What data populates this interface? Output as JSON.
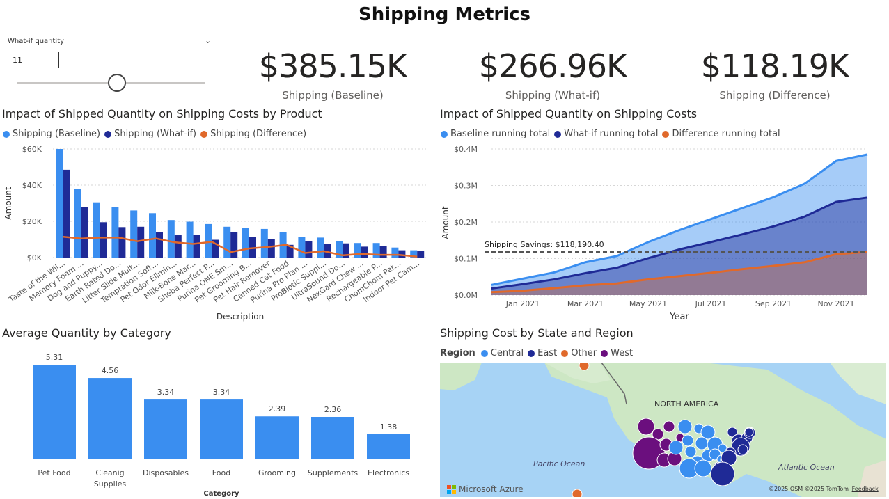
{
  "report": {
    "title": "Shipping Metrics"
  },
  "slicer": {
    "label": "What-if quantity",
    "value": "11",
    "slider_fraction": 0.53
  },
  "kpis": [
    {
      "value": "$385.15K",
      "label": "Shipping (Baseline)"
    },
    {
      "value": "$266.96K",
      "label": "Shipping (What-if)"
    },
    {
      "value": "$118.19K",
      "label": "Shipping (Difference)"
    }
  ],
  "colors": {
    "baseline": "#3a8ef0",
    "whatif": "#1f2a96",
    "difference": "#e0692b",
    "west": "#6b0f7e",
    "other": "#e0692b",
    "map_water": "#a7d3f5",
    "map_land": "#cde7c4"
  },
  "product_chart": {
    "title": "Impact of Shipped Quantity on Shipping Costs by Product",
    "legend": [
      "Shipping (Baseline)",
      "Shipping (What-if)",
      "Shipping (Difference)"
    ],
    "ylabel": "Amount",
    "xlabel": "Description",
    "chart_data": {
      "type": "bar",
      "y_ticks": [
        "$0K",
        "$20K",
        "$40K",
        "$60K"
      ],
      "ylim": [
        0,
        60000
      ],
      "categories": [
        "Taste of the Wil...",
        "Memory Foam ...",
        "Dog and Puppy...",
        "Earth Rated Do...",
        "Litter Slide Mult...",
        "Temptation Soft...",
        "Pet Odor Elimin...",
        "Milk-Bone Mar...",
        "Sheba Perfect P...",
        "Purina ONE Sm...",
        "Pet Grooming B...",
        "Pet Hair Remover",
        "Canned Cat Food",
        "Purina Pro Plan ...",
        "ProBiotic Suppl...",
        "UltraSound Do...",
        "NexGard Chew ...",
        "Rechargeable P...",
        "ChomChom Pet...",
        "Indoor Pet Cam..."
      ],
      "series": [
        {
          "name": "Shipping (Baseline)",
          "values": [
            60000,
            38000,
            30500,
            27800,
            26000,
            24500,
            20700,
            19800,
            18500,
            17000,
            16500,
            15800,
            14000,
            11500,
            11000,
            9000,
            8000,
            8000,
            5500,
            4000
          ]
        },
        {
          "name": "Shipping (What-if)",
          "values": [
            48500,
            28000,
            19500,
            16800,
            17000,
            14000,
            12300,
            12500,
            9800,
            14000,
            11500,
            10000,
            7000,
            9000,
            7500,
            7800,
            6000,
            6500,
            4000,
            3500
          ]
        },
        {
          "name": "Shipping (Difference)",
          "values": [
            11500,
            10500,
            11000,
            11000,
            9000,
            10500,
            8400,
            7500,
            8700,
            3000,
            5000,
            5800,
            7000,
            2500,
            3500,
            1200,
            2000,
            1500,
            1500,
            500
          ]
        }
      ]
    }
  },
  "running_chart": {
    "title": "Impact of Shipped Quantity on Shipping Costs",
    "legend": [
      "Baseline running total",
      "What-if running total",
      "Difference running total"
    ],
    "ylabel": "Amount",
    "xlabel": "Year",
    "annotation": "Shipping Savings: $118,190.40",
    "chart_data": {
      "type": "area",
      "y_ticks": [
        "$0.0M",
        "$0.1M",
        "$0.2M",
        "$0.3M",
        "$0.4M"
      ],
      "ylim": [
        0,
        400000
      ],
      "x_ticks": [
        "Jan 2021",
        "Mar 2021",
        "May 2021",
        "Jul 2021",
        "Sep 2021",
        "Nov 2021"
      ],
      "x": [
        "Dec 2020",
        "Jan 2021",
        "Feb 2021",
        "Mar 2021",
        "Apr 2021",
        "May 2021",
        "Jun 2021",
        "Jul 2021",
        "Aug 2021",
        "Sep 2021",
        "Oct 2021",
        "Nov 2021",
        "Dec 2021"
      ],
      "series": [
        {
          "name": "Baseline running total",
          "values": [
            28000,
            45000,
            62000,
            90000,
            107000,
            145000,
            178000,
            208000,
            238000,
            268000,
            305000,
            367000,
            385000
          ]
        },
        {
          "name": "What-if running total",
          "values": [
            18000,
            30000,
            43000,
            60000,
            75000,
            101000,
            125000,
            145000,
            166000,
            188000,
            215000,
            255000,
            267000
          ]
        },
        {
          "name": "Difference running total",
          "values": [
            8000,
            12000,
            19000,
            27000,
            32000,
            43000,
            52000,
            61000,
            71000,
            80000,
            90000,
            112000,
            118000
          ]
        }
      ],
      "reference_line": 118190.4
    }
  },
  "category_chart": {
    "title": "Average Quantity by Category",
    "xlabel": "Category",
    "chart_data": {
      "type": "bar",
      "categories": [
        "Pet Food",
        "Cleanig Supplies",
        "Disposables",
        "Food",
        "Grooming",
        "Supplements",
        "Electronics"
      ],
      "category_lines": [
        [
          "Pet Food"
        ],
        [
          "Cleanig",
          "Supplies"
        ],
        [
          "Disposables"
        ],
        [
          "Food"
        ],
        [
          "Grooming"
        ],
        [
          "Supplements"
        ],
        [
          "Electronics"
        ]
      ],
      "values": [
        5.31,
        4.56,
        3.34,
        3.34,
        2.39,
        2.36,
        1.38
      ],
      "labels": [
        "5.31",
        "4.56",
        "3.34",
        "3.34",
        "2.39",
        "2.36",
        "1.38"
      ],
      "ylim": [
        0,
        5.31
      ]
    }
  },
  "map": {
    "title": "Shipping Cost by State and Region",
    "legend_title": "Region",
    "legend": [
      "Central",
      "East",
      "Other",
      "West"
    ],
    "label_continent": "NORTH AMERICA",
    "label_pacific": "Pacific Ocean",
    "label_atlantic": "Atlantic Ocean",
    "brand": "Microsoft Azure",
    "credits": "©2025 OSM  ©2025 TomTom",
    "feedback": "Feedback"
  }
}
